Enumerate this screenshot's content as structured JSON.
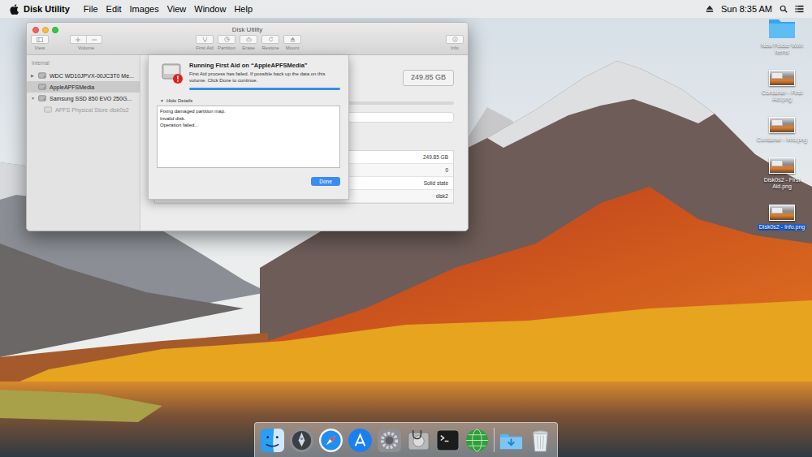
{
  "menubar": {
    "app": "Disk Utility",
    "menus": [
      "File",
      "Edit",
      "Images",
      "View",
      "Window",
      "Help"
    ],
    "clock": "Sun 8:35 AM"
  },
  "window": {
    "title": "Disk Utility",
    "toolbar": [
      {
        "label": "View"
      },
      {
        "label": "Volume"
      },
      {
        "label": "First Aid"
      },
      {
        "label": "Partition"
      },
      {
        "label": "Erase"
      },
      {
        "label": "Restore"
      },
      {
        "label": "Mount"
      },
      {
        "label": "Info"
      }
    ]
  },
  "sidebar": {
    "header": "Internal",
    "items": [
      {
        "label": "WDC WD10JPVX-00JC3T0 Me...",
        "kind": "disk",
        "disclosure": "▶",
        "selected": false,
        "disabled": false
      },
      {
        "label": "AppleAPFSMedia",
        "kind": "disk",
        "selected": true,
        "disabled": false
      },
      {
        "label": "Samsung SSD 850 EVO 250G...",
        "kind": "disk",
        "disclosure": "▼",
        "selected": false,
        "disabled": false
      },
      {
        "label": "APFS Physical Store disk0s2",
        "kind": "volume",
        "selected": false,
        "disabled": true
      }
    ]
  },
  "info": {
    "capacity": "249.85 GB",
    "rows": [
      "249.85 GB",
      "0",
      "Solid state",
      "disk2"
    ]
  },
  "sheet": {
    "title": "Running First Aid on “AppleAPFSMedia”",
    "message": "First Aid process has failed. If possible back up the data on this volume. Click Done to continue.",
    "progress": {
      "level": 1
    },
    "details_toggle": {
      "icon": "▼",
      "label": "Hide Details",
      "expanded": true
    },
    "details": [
      "Fixing damaged partition map.",
      "Invalid disk.",
      "Operation failed…"
    ],
    "button": "Done"
  },
  "desktop_icons": [
    {
      "label": "New Folder With Items",
      "kind": "folder",
      "selected": false
    },
    {
      "label": "Container - First Aid.png",
      "kind": "image",
      "selected": false
    },
    {
      "label": "Container - Info.png",
      "kind": "image",
      "selected": false
    },
    {
      "label": "Disk0s2 - First Aid.png",
      "kind": "image",
      "selected": false
    },
    {
      "label": "Disk0s2 - Info.png",
      "kind": "image",
      "selected": true
    }
  ]
}
